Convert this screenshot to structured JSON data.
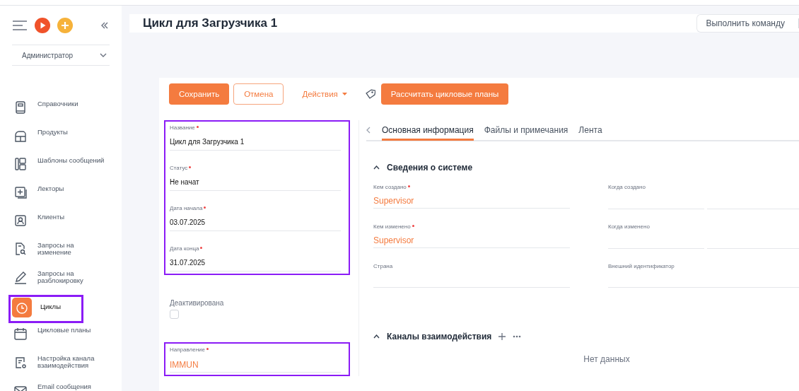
{
  "sidebar": {
    "role": "Администратор",
    "items": [
      {
        "label": "Справочники",
        "selected": false,
        "highlighted": false
      },
      {
        "label": "Продукты",
        "selected": false,
        "highlighted": false
      },
      {
        "label": "Шаблоны сообщений",
        "selected": false,
        "highlighted": false
      },
      {
        "label": "Лекторы",
        "selected": false,
        "highlighted": false
      },
      {
        "label": "Клиенты",
        "selected": false,
        "highlighted": false
      },
      {
        "label": "Запросы на изменение",
        "selected": false,
        "highlighted": false
      },
      {
        "label": "Запросы на разблокировку",
        "selected": false,
        "highlighted": false
      },
      {
        "label": "Циклы",
        "selected": true,
        "highlighted": true
      },
      {
        "label": "Цикловые планы",
        "selected": false,
        "highlighted": false
      },
      {
        "label": "Настройка канала взаимодействия",
        "selected": false,
        "highlighted": false
      },
      {
        "label": "Email сообщения",
        "selected": false,
        "highlighted": false
      }
    ]
  },
  "header": {
    "title": "Цикл для Загрузчика 1",
    "command_button": "Выполнить команду"
  },
  "toolbar": {
    "save": "Сохранить",
    "cancel": "Отмена",
    "actions": "Действия",
    "calculate": "Рассчитать цикловые планы"
  },
  "form_groups": [
    {
      "highlighted": true,
      "fields": [
        {
          "kind": "text",
          "label": "Название",
          "required": true,
          "value": "Цикл для Загрузчика 1"
        },
        {
          "kind": "text",
          "label": "Статус",
          "required": true,
          "value": "Не начат"
        },
        {
          "kind": "text",
          "label": "Дата начала",
          "required": true,
          "value": "03.07.2025"
        },
        {
          "kind": "text",
          "label": "Дата конца",
          "required": true,
          "value": "31.07.2025"
        }
      ]
    },
    {
      "highlighted": false,
      "fields": [
        {
          "kind": "checkbox",
          "label": "Деактивирована",
          "checked": false
        }
      ]
    },
    {
      "highlighted": true,
      "fields": [
        {
          "kind": "link",
          "label": "Направление",
          "required": true,
          "value": "IMMUN"
        }
      ]
    }
  ],
  "tabs": [
    {
      "label": "Основная информация",
      "selected": true
    },
    {
      "label": "Файлы и примечания",
      "selected": false
    },
    {
      "label": "Лента",
      "selected": false
    }
  ],
  "system_section": {
    "title": "Сведения о системе",
    "expanded": true,
    "fields": [
      {
        "kind": "link",
        "label": "Кем создано",
        "required": true,
        "value": "Supervisor"
      },
      {
        "kind": "datetime",
        "label": "Когда создано",
        "required": false
      },
      {
        "kind": "link",
        "label": "Кем изменено",
        "required": true,
        "value": "Supervisor"
      },
      {
        "kind": "datetime",
        "label": "Когда изменено",
        "required": false
      },
      {
        "kind": "empty",
        "label": "Страна",
        "required": false
      },
      {
        "kind": "empty",
        "label": "Внешний идентификатор",
        "required": false
      }
    ]
  },
  "channels_section": {
    "title": "Каналы взаимодействия",
    "expanded": true,
    "empty_text": "Нет данных"
  }
}
